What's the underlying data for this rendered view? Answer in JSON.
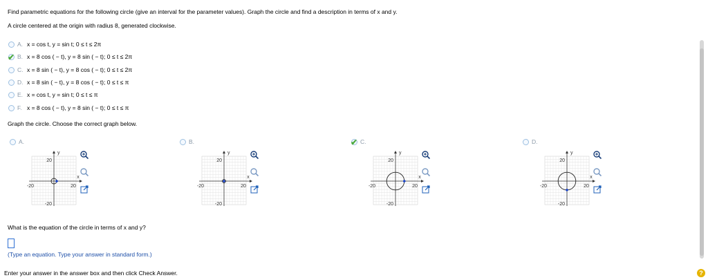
{
  "problem": {
    "statement": "Find parametric equations for the following circle (give an interval for the parameter values). Graph the circle and find a description in terms of x and y.",
    "sub": "A circle centered at the origin with radius 8, generated clockwise."
  },
  "choices": [
    {
      "letter": "A.",
      "formula": "x = cos t, y = sin t; 0 ≤ t ≤ 2π",
      "selected": false
    },
    {
      "letter": "B.",
      "formula": "x = 8 cos ( − t), y = 8 sin ( − t); 0 ≤ t ≤ 2π",
      "selected": true
    },
    {
      "letter": "C.",
      "formula": "x = 8 sin ( − t), y = 8 cos ( − t); 0 ≤ t ≤ 2π",
      "selected": false
    },
    {
      "letter": "D.",
      "formula": "x = 8 sin ( − t), y = 8 cos ( − t); 0 ≤ t ≤ π",
      "selected": false
    },
    {
      "letter": "E.",
      "formula": "x = cos t, y = sin t; 0 ≤ t ≤ π",
      "selected": false
    },
    {
      "letter": "F.",
      "formula": "x = 8 cos ( − t), y = 8 sin ( − t); 0 ≤ t ≤ π",
      "selected": false
    }
  ],
  "graph_prompt": "Graph the circle. Choose the correct graph below.",
  "graphs": [
    {
      "letter": "A.",
      "selected": false,
      "circle": "small",
      "ticks": {
        "ymax": "20",
        "ymin": "-20",
        "xmin": "-20",
        "xmax": "20"
      },
      "ylabel": "y",
      "xlabel": "x"
    },
    {
      "letter": "B.",
      "selected": false,
      "circle": "tiny",
      "ticks": {
        "ymax": "20",
        "ymin": "-20",
        "xmin": "-20",
        "xmax": "20"
      },
      "ylabel": "y",
      "xlabel": "x"
    },
    {
      "letter": "C.",
      "selected": true,
      "circle": "radius8",
      "ticks": {
        "ymax": "20",
        "ymin": "-20",
        "xmin": "-20",
        "xmax": "20"
      },
      "ylabel": "y",
      "xlabel": "x"
    },
    {
      "letter": "D.",
      "selected": false,
      "circle": "radius8-alt",
      "ticks": {
        "ymax": "20",
        "ymin": "-20",
        "xmin": "-20",
        "xmax": "20"
      },
      "ylabel": "y",
      "xlabel": "x"
    }
  ],
  "question2": "What is the equation of the circle in terms of x and y?",
  "hint": "(Type an equation. Type your answer in standard form.)",
  "footer": "Enter your answer in the answer box and then click Check Answer.",
  "help_label": "?",
  "colors": {
    "radio_border": "#9cbfe0",
    "check": "#4caa3c",
    "hint": "#1d4fa8",
    "answer_border": "#2e6fd3",
    "help": "#e6b400",
    "circle_dot": "#1a44c8"
  },
  "icons": [
    "zoom-in-icon",
    "zoom-out-icon",
    "open-external-icon",
    "check-icon",
    "help-icon"
  ]
}
